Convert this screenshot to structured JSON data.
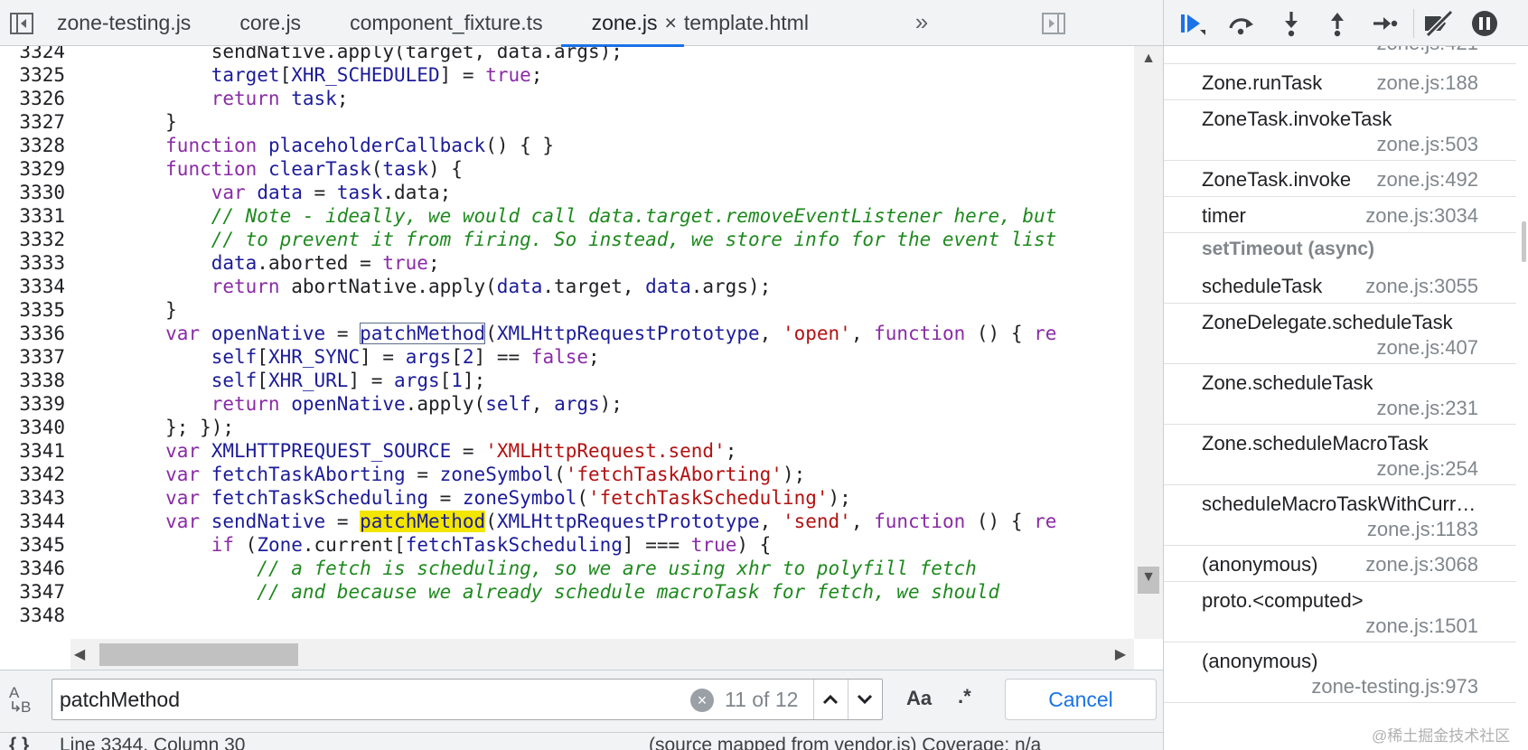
{
  "tabs": [
    {
      "label": "zone-testing.js",
      "active": false
    },
    {
      "label": "core.js",
      "active": false
    },
    {
      "label": "component_fixture.ts",
      "active": false
    },
    {
      "label": "zone.js",
      "active": true,
      "closable": true
    },
    {
      "label": "template.html",
      "active": false
    }
  ],
  "tab_close_glyph": "×",
  "tab_more_glyph": "»",
  "code_lines": [
    {
      "n": "3324",
      "tokens": [
        [
          "t",
          "            sendNative.apply(target, data.args);"
        ]
      ]
    },
    {
      "n": "3325",
      "tokens": [
        [
          "t",
          "            "
        ],
        [
          "id",
          "target"
        ],
        [
          "t",
          "["
        ],
        [
          "id",
          "XHR_SCHEDULED"
        ],
        [
          "t",
          "] = "
        ],
        [
          "kw",
          "true"
        ],
        [
          "t",
          ";"
        ]
      ]
    },
    {
      "n": "3326",
      "tokens": [
        [
          "t",
          "            "
        ],
        [
          "kw",
          "return"
        ],
        [
          "t",
          " "
        ],
        [
          "id",
          "task"
        ],
        [
          "t",
          ";"
        ]
      ]
    },
    {
      "n": "3327",
      "tokens": [
        [
          "t",
          "        }"
        ]
      ]
    },
    {
      "n": "3328",
      "tokens": [
        [
          "t",
          "        "
        ],
        [
          "kw",
          "function"
        ],
        [
          "t",
          " "
        ],
        [
          "id",
          "placeholderCallback"
        ],
        [
          "t",
          "() { }"
        ]
      ]
    },
    {
      "n": "3329",
      "tokens": [
        [
          "t",
          "        "
        ],
        [
          "kw",
          "function"
        ],
        [
          "t",
          " "
        ],
        [
          "id",
          "clearTask"
        ],
        [
          "t",
          "("
        ],
        [
          "id",
          "task"
        ],
        [
          "t",
          ") {"
        ]
      ]
    },
    {
      "n": "3330",
      "tokens": [
        [
          "t",
          "            "
        ],
        [
          "kw",
          "var"
        ],
        [
          "t",
          " "
        ],
        [
          "id",
          "data"
        ],
        [
          "t",
          " = "
        ],
        [
          "id",
          "task"
        ],
        [
          "t",
          ".data;"
        ]
      ]
    },
    {
      "n": "3331",
      "tokens": [
        [
          "t",
          "            "
        ],
        [
          "cm",
          "// Note - ideally, we would call data.target.removeEventListener here, but"
        ]
      ]
    },
    {
      "n": "3332",
      "tokens": [
        [
          "t",
          "            "
        ],
        [
          "cm",
          "// to prevent it from firing. So instead, we store info for the event list"
        ]
      ]
    },
    {
      "n": "3333",
      "tokens": [
        [
          "t",
          "            "
        ],
        [
          "id",
          "data"
        ],
        [
          "t",
          ".aborted = "
        ],
        [
          "kw",
          "true"
        ],
        [
          "t",
          ";"
        ]
      ]
    },
    {
      "n": "3334",
      "tokens": [
        [
          "t",
          "            "
        ],
        [
          "kw",
          "return"
        ],
        [
          "t",
          " abortNative.apply("
        ],
        [
          "id",
          "data"
        ],
        [
          "t",
          ".target, "
        ],
        [
          "id",
          "data"
        ],
        [
          "t",
          ".args);"
        ]
      ]
    },
    {
      "n": "3335",
      "tokens": [
        [
          "t",
          "        }"
        ]
      ]
    },
    {
      "n": "3336",
      "tokens": [
        [
          "t",
          "        "
        ],
        [
          "kw",
          "var"
        ],
        [
          "t",
          " "
        ],
        [
          "id",
          "openNative"
        ],
        [
          "t",
          " = "
        ],
        [
          "box",
          "patchMethod"
        ],
        [
          "t",
          "("
        ],
        [
          "id",
          "XMLHttpRequestPrototype"
        ],
        [
          "t",
          ", "
        ],
        [
          "str",
          "'open'"
        ],
        [
          "t",
          ", "
        ],
        [
          "kw",
          "function"
        ],
        [
          "t",
          " () { "
        ],
        [
          "kw",
          "re"
        ]
      ]
    },
    {
      "n": "3337",
      "tokens": [
        [
          "t",
          "            "
        ],
        [
          "id",
          "self"
        ],
        [
          "t",
          "["
        ],
        [
          "id",
          "XHR_SYNC"
        ],
        [
          "t",
          "] = "
        ],
        [
          "id",
          "args"
        ],
        [
          "t",
          "["
        ],
        [
          "num",
          "2"
        ],
        [
          "t",
          "] == "
        ],
        [
          "kw",
          "false"
        ],
        [
          "t",
          ";"
        ]
      ]
    },
    {
      "n": "3338",
      "tokens": [
        [
          "t",
          "            "
        ],
        [
          "id",
          "self"
        ],
        [
          "t",
          "["
        ],
        [
          "id",
          "XHR_URL"
        ],
        [
          "t",
          "] = "
        ],
        [
          "id",
          "args"
        ],
        [
          "t",
          "["
        ],
        [
          "num",
          "1"
        ],
        [
          "t",
          "];"
        ]
      ]
    },
    {
      "n": "3339",
      "tokens": [
        [
          "t",
          "            "
        ],
        [
          "kw",
          "return"
        ],
        [
          "t",
          " "
        ],
        [
          "id",
          "openNative"
        ],
        [
          "t",
          ".apply("
        ],
        [
          "id",
          "self"
        ],
        [
          "t",
          ", "
        ],
        [
          "id",
          "args"
        ],
        [
          "t",
          ");"
        ]
      ]
    },
    {
      "n": "3340",
      "tokens": [
        [
          "t",
          "        }; });"
        ]
      ]
    },
    {
      "n": "3341",
      "tokens": [
        [
          "t",
          "        "
        ],
        [
          "kw",
          "var"
        ],
        [
          "t",
          " "
        ],
        [
          "id",
          "XMLHTTPREQUEST_SOURCE"
        ],
        [
          "t",
          " = "
        ],
        [
          "str",
          "'XMLHttpRequest.send'"
        ],
        [
          "t",
          ";"
        ]
      ]
    },
    {
      "n": "3342",
      "tokens": [
        [
          "t",
          "        "
        ],
        [
          "kw",
          "var"
        ],
        [
          "t",
          " "
        ],
        [
          "id",
          "fetchTaskAborting"
        ],
        [
          "t",
          " = "
        ],
        [
          "id",
          "zoneSymbol"
        ],
        [
          "t",
          "("
        ],
        [
          "str",
          "'fetchTaskAborting'"
        ],
        [
          "t",
          ");"
        ]
      ]
    },
    {
      "n": "3343",
      "tokens": [
        [
          "t",
          "        "
        ],
        [
          "kw",
          "var"
        ],
        [
          "t",
          " "
        ],
        [
          "id",
          "fetchTaskScheduling"
        ],
        [
          "t",
          " = "
        ],
        [
          "id",
          "zoneSymbol"
        ],
        [
          "t",
          "("
        ],
        [
          "str",
          "'fetchTaskScheduling'"
        ],
        [
          "t",
          ");"
        ]
      ]
    },
    {
      "n": "3344",
      "tokens": [
        [
          "t",
          "        "
        ],
        [
          "kw",
          "var"
        ],
        [
          "t",
          " "
        ],
        [
          "id",
          "sendNative"
        ],
        [
          "t",
          " = "
        ],
        [
          "cur",
          "patchMethod"
        ],
        [
          "t",
          "("
        ],
        [
          "id",
          "XMLHttpRequestPrototype"
        ],
        [
          "t",
          ", "
        ],
        [
          "str",
          "'send'"
        ],
        [
          "t",
          ", "
        ],
        [
          "kw",
          "function"
        ],
        [
          "t",
          " () { "
        ],
        [
          "kw",
          "re"
        ]
      ]
    },
    {
      "n": "3345",
      "tokens": [
        [
          "t",
          "            "
        ],
        [
          "kw",
          "if"
        ],
        [
          "t",
          " ("
        ],
        [
          "id",
          "Zone"
        ],
        [
          "t",
          ".current["
        ],
        [
          "id",
          "fetchTaskScheduling"
        ],
        [
          "t",
          "] === "
        ],
        [
          "kw",
          "true"
        ],
        [
          "t",
          ") {"
        ]
      ]
    },
    {
      "n": "3346",
      "tokens": [
        [
          "t",
          "                "
        ],
        [
          "cm",
          "// a fetch is scheduling, so we are using xhr to polyfill fetch"
        ]
      ]
    },
    {
      "n": "3347",
      "tokens": [
        [
          "t",
          "                "
        ],
        [
          "cm",
          "// and because we already schedule macroTask for fetch, we should"
        ]
      ]
    },
    {
      "n": "3348",
      "tokens": [
        [
          "t",
          ""
        ]
      ]
    }
  ],
  "search": {
    "query": "patchMethod",
    "count": "11 of 12",
    "case_label": "Aa",
    "regex_label": ".*",
    "cancel_label": "Cancel",
    "prev_glyph": "⌃",
    "next_glyph": "⌄",
    "clear_glyph": "×"
  },
  "status": {
    "braces": "{ }",
    "position": "Line 3344, Column 30",
    "source": "(source mapped from vendor.js) Coverage: n/a"
  },
  "call_stack": [
    {
      "name": "",
      "loc": "zone.js:421",
      "partial": true
    },
    {
      "name": "Zone.runTask",
      "loc": "zone.js:188"
    },
    {
      "name": "ZoneTask.invokeTask",
      "loc": "zone.js:503",
      "wrap": true
    },
    {
      "name": "ZoneTask.invoke",
      "loc": "zone.js:492"
    },
    {
      "name": "timer",
      "loc": "zone.js:3034"
    },
    {
      "async": "setTimeout (async)"
    },
    {
      "name": "scheduleTask",
      "loc": "zone.js:3055"
    },
    {
      "name": "ZoneDelegate.scheduleTask",
      "loc": "zone.js:407",
      "wrap": true
    },
    {
      "name": "Zone.scheduleTask",
      "loc": "zone.js:231",
      "wrap": true
    },
    {
      "name": "Zone.scheduleMacroTask",
      "loc": "zone.js:254",
      "wrap": true
    },
    {
      "name": "scheduleMacroTaskWithCurre...",
      "loc": "zone.js:1183",
      "wrap": true
    },
    {
      "name": "(anonymous)",
      "loc": "zone.js:3068"
    },
    {
      "name": "proto.<computed>",
      "loc": "zone.js:1501",
      "wrap": true
    },
    {
      "name": "(anonymous)",
      "loc": "zone-testing.js:973",
      "wrap": true
    }
  ],
  "watermark": "@稀土掘金技术社区",
  "colors": {
    "keyword": "#8a2ba6",
    "identifier": "#1c1c99",
    "string": "#b31111",
    "comment": "#1e8a1e",
    "highlight": "#f2e600",
    "accent": "#1a73e8"
  }
}
